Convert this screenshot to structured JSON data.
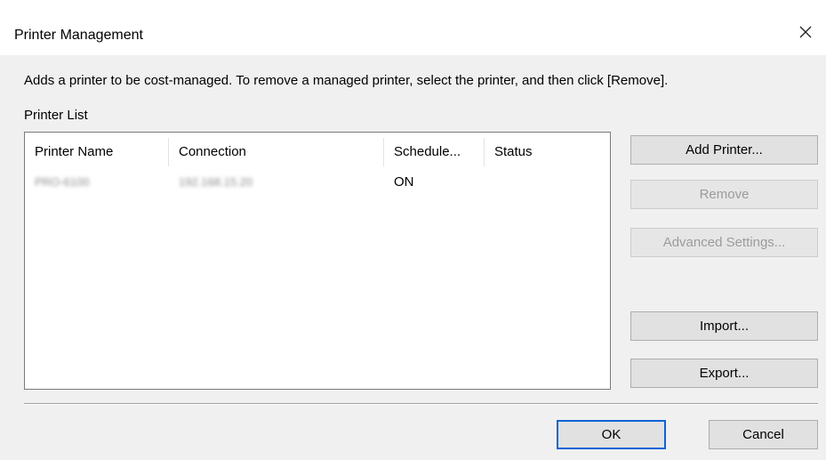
{
  "window": {
    "title": "Printer Management",
    "close_icon": "close-icon"
  },
  "description": "Adds a printer to be cost-managed. To remove a managed printer, select the printer, and then click [Remove].",
  "printer_list": {
    "label": "Printer List",
    "columns": [
      "Printer Name",
      "Connection",
      "Schedule...",
      "Status"
    ],
    "rows": [
      {
        "printer_name": "PRO-6100",
        "connection": "192.168.15.20",
        "schedule": "ON",
        "status": ""
      }
    ]
  },
  "side_buttons": {
    "add_printer": "Add Printer...",
    "remove": "Remove",
    "advanced_settings": "Advanced Settings...",
    "import": "Import...",
    "export": "Export..."
  },
  "footer_buttons": {
    "ok": "OK",
    "cancel": "Cancel"
  },
  "colors": {
    "dialog_bg": "#f0f0f0",
    "titlebar_bg": "#ffffff",
    "default_button_border": "#0a64d8",
    "disabled_text": "#9b9b9b"
  }
}
